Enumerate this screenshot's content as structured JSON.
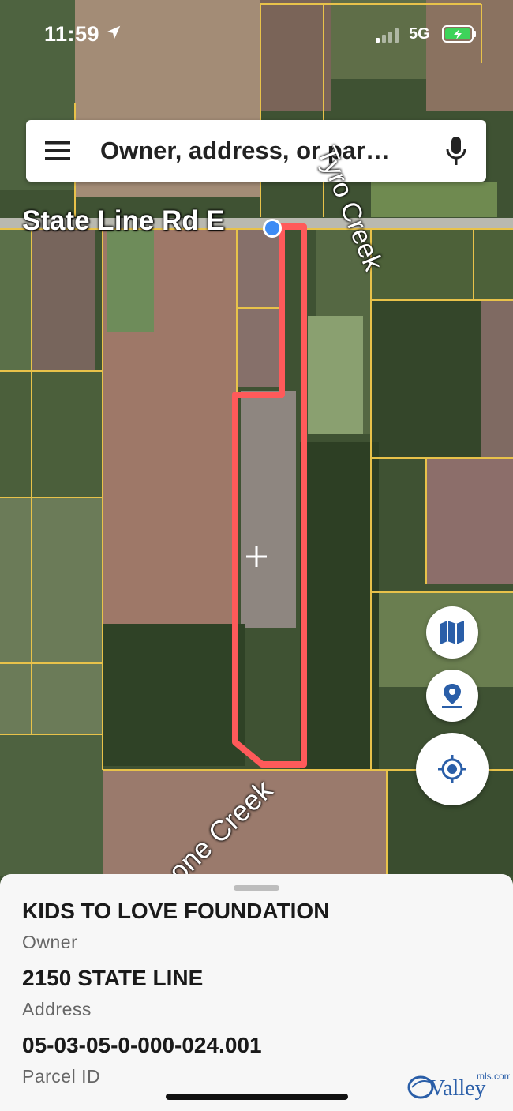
{
  "status_bar": {
    "time": "11:59",
    "network": "5G"
  },
  "search": {
    "placeholder": "Owner, address, or par…"
  },
  "map": {
    "road_label": "State Line Rd E",
    "creek_label_1": "Tyro Creek",
    "creek_label_2": "one Creek"
  },
  "sheet": {
    "owner_value": "KIDS TO LOVE FOUNDATION",
    "owner_label": "Owner",
    "address_value": "2150 STATE LINE",
    "address_label": "Address",
    "parcel_value": "05-03-05-0-000-024.001",
    "parcel_label": "Parcel ID"
  },
  "watermark": {
    "text_main": "Valley",
    "text_small": "mls.com"
  },
  "colors": {
    "parcel_outline": "#ff5a5a",
    "parcel_lines": "#e8c24a",
    "location_dot": "#3d8cf5",
    "fab_icon": "#2a5ea8"
  },
  "icons": {
    "status": [
      "location-arrow-icon",
      "signal-icon",
      "battery-charging-icon"
    ],
    "search": [
      "menu-icon",
      "mic-icon"
    ],
    "fabs": [
      "map-layers-icon",
      "marker-icon",
      "my-location-icon"
    ]
  }
}
